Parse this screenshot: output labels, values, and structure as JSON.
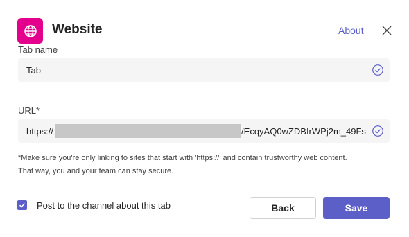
{
  "header": {
    "title": "Website",
    "about_label": "About",
    "app_icon": "globe-icon",
    "close_icon": "close-icon",
    "icon_bg": "#e3008c"
  },
  "tab_name": {
    "label": "Tab name",
    "value": "Tab",
    "status_icon": "check-circle-icon"
  },
  "url": {
    "label": "URL*",
    "value_prefix": "https://",
    "value_suffix": "/EcqyAQ0wZDBIrWPj2m_49Fs",
    "status_icon": "check-circle-icon"
  },
  "note": {
    "line1": "*Make sure you're only linking to sites that start with 'https://' and contain trustworthy web content.",
    "line2": "That way, you and your team can stay secure."
  },
  "post_option": {
    "label": "Post to the channel about this tab",
    "checked": true
  },
  "buttons": {
    "back_label": "Back",
    "save_label": "Save"
  },
  "colors": {
    "accent": "#5b5fc7",
    "brand": "#e3008c"
  }
}
